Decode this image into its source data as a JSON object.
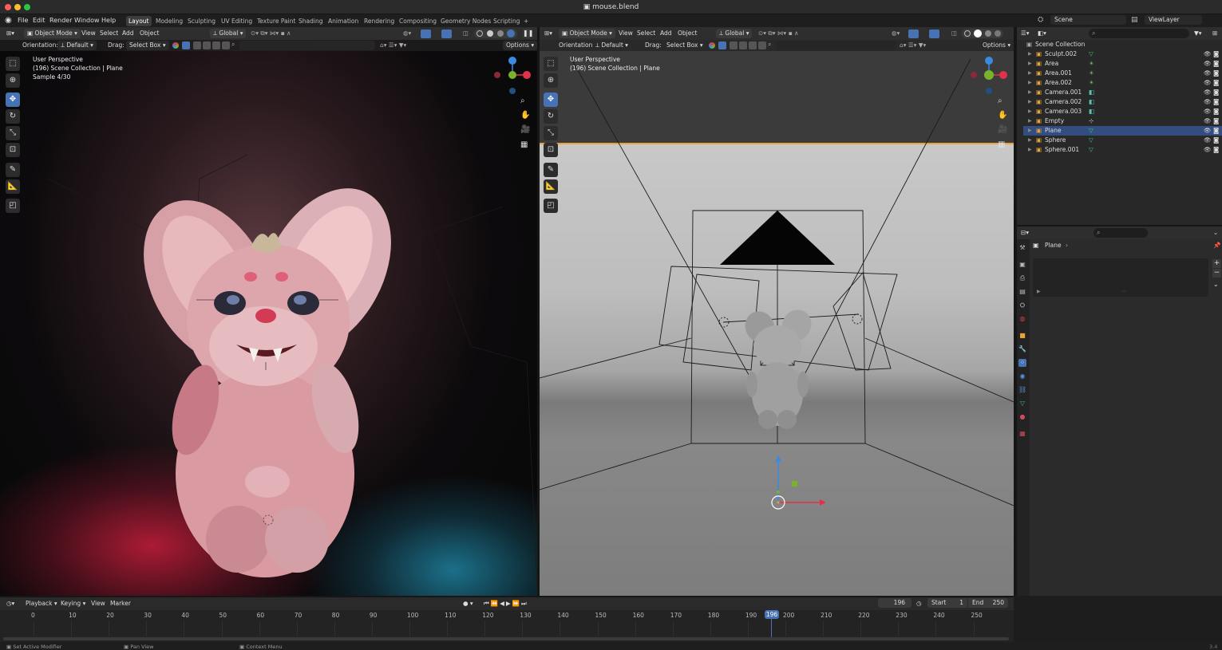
{
  "window": {
    "title": "mouse.blend"
  },
  "menus": [
    "File",
    "Edit",
    "Render",
    "Window",
    "Help"
  ],
  "workspaces": [
    "Layout",
    "Modeling",
    "Sculpting",
    "UV Editing",
    "Texture Paint",
    "Shading",
    "Animation",
    "Rendering",
    "Compositing",
    "Geometry Nodes",
    "Scripting"
  ],
  "scene": {
    "name": "Scene",
    "view_layer": "ViewLayer"
  },
  "viewport_header": {
    "mode": "Object Mode",
    "view": "View",
    "select": "Select",
    "add": "Add",
    "object": "Object",
    "transform": "Global",
    "orientation_label": "Orientation:",
    "orientation_value": "Default",
    "drag_label": "Drag:",
    "drag_value": "Select Box",
    "options": "Options"
  },
  "viewport_left": {
    "perspective": "User Perspective",
    "collection": "(196) Scene Collection | Plane",
    "sample": "Sample 4/30"
  },
  "viewport_right": {
    "perspective": "User Perspective",
    "collection": "(196) Scene Collection | Plane"
  },
  "outliner": {
    "root": "Scene Collection",
    "items": [
      {
        "name": "Sculpt.002",
        "type": "mesh"
      },
      {
        "name": "Area",
        "type": "light"
      },
      {
        "name": "Area.001",
        "type": "light"
      },
      {
        "name": "Area.002",
        "type": "light"
      },
      {
        "name": "Camera.001",
        "type": "camera"
      },
      {
        "name": "Camera.002",
        "type": "camera"
      },
      {
        "name": "Camera.003",
        "type": "camera"
      },
      {
        "name": "Empty",
        "type": "empty"
      },
      {
        "name": "Plane",
        "type": "mesh",
        "selected": true
      },
      {
        "name": "Sphere",
        "type": "mesh"
      },
      {
        "name": "Sphere.001",
        "type": "mesh"
      }
    ]
  },
  "properties": {
    "object": "Plane"
  },
  "timeline": {
    "playback": "Playback",
    "keying": "Keying",
    "view": "View",
    "marker": "Marker",
    "current_frame": "196",
    "start_label": "Start",
    "start": "1",
    "end_label": "End",
    "end": "250",
    "ticks": [
      "0",
      "10",
      "20",
      "30",
      "40",
      "50",
      "60",
      "70",
      "80",
      "90",
      "100",
      "110",
      "120",
      "130",
      "140",
      "150",
      "160",
      "170",
      "180",
      "190",
      "200",
      "210",
      "220",
      "230",
      "240",
      "250"
    ]
  },
  "statusbar": {
    "left": "Set Active Modifier",
    "middle": "Pan View",
    "right": "Context Menu",
    "version": "3.4"
  },
  "colors": {
    "accent": "#4772b3",
    "selected_row": "#334d80",
    "active_edge": "#e8a33a",
    "axis_x": "#e0334a",
    "axis_y": "#7bb22c",
    "axis_z": "#3b8ae0"
  }
}
